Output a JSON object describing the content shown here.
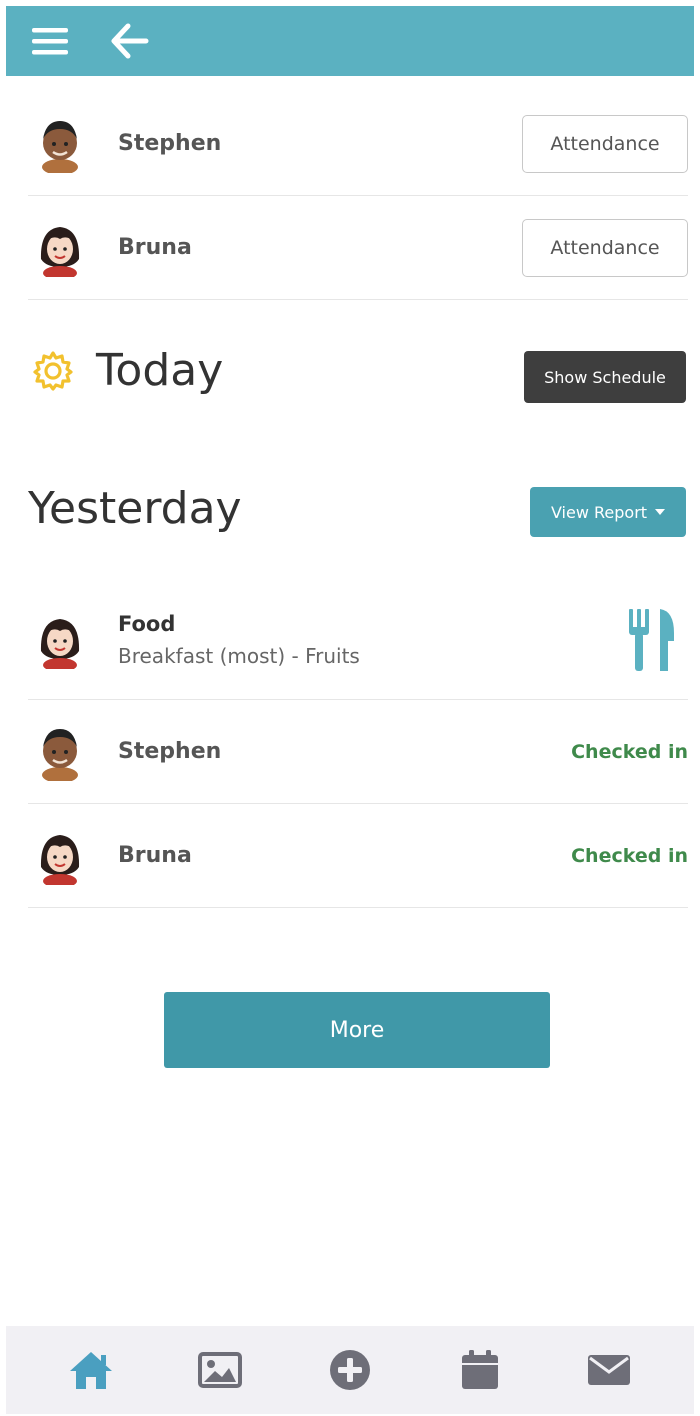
{
  "colors": {
    "header": "#5bb1c1",
    "accent": "#4098a8",
    "checked": "#3f8a4b",
    "dark_button": "#3e3e3e",
    "icon_gray": "#6e6e78",
    "home_active": "#4a9fc0"
  },
  "header": {
    "menu_icon": "hamburger-menu-icon",
    "back_icon": "arrow-left-icon"
  },
  "children": [
    {
      "name": "Stephen",
      "button_label": "Attendance",
      "avatar": "boy-avatar"
    },
    {
      "name": "Bruna",
      "button_label": "Attendance",
      "avatar": "girl-avatar"
    }
  ],
  "today": {
    "heading": "Today",
    "icon": "sun-gear-icon",
    "button_label": "Show Schedule"
  },
  "yesterday": {
    "heading": "Yesterday",
    "button_label": "View Report",
    "entries": [
      {
        "type": "food",
        "title": "Food",
        "description": "Breakfast (most) - Fruits",
        "icon": "fork-knife-icon"
      },
      {
        "type": "checkin",
        "name": "Stephen",
        "status": "Checked in"
      },
      {
        "type": "checkin",
        "name": "Bruna",
        "status": "Checked in"
      }
    ]
  },
  "more_label": "More",
  "bottom_nav": [
    {
      "icon": "home-icon",
      "active": true
    },
    {
      "icon": "image-icon",
      "active": false
    },
    {
      "icon": "plus-circle-icon",
      "active": false
    },
    {
      "icon": "calendar-icon",
      "active": false
    },
    {
      "icon": "envelope-icon",
      "active": false
    }
  ]
}
